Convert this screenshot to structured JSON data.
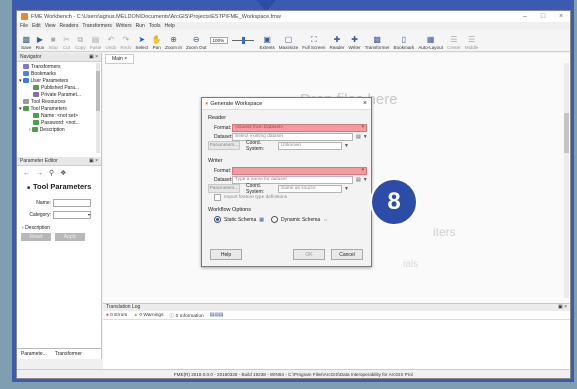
{
  "window": {
    "title": "FME Workbench - C:\\Users\\agnus.MELDON\\Documents\\ArcGIS\\Projects\\ESTP\\FME_Workspace.fmw"
  },
  "menu": [
    "File",
    "Edit",
    "View",
    "Readers",
    "Transformers",
    "Writers",
    "Run",
    "Tools",
    "Help"
  ],
  "toolbar": {
    "buttons": [
      "Save",
      "Run",
      "Stop",
      "Cut",
      "Copy",
      "Paste",
      "Undo",
      "Redo",
      "Select",
      "Pan",
      "Zoom In",
      "Zoom Out"
    ],
    "zoom": "100%",
    "right_buttons": [
      "Extents",
      "Maximize",
      "Full Screen",
      "Reader",
      "Writer",
      "Transformer",
      "Bookmark",
      "Auto-Layout",
      "Center",
      "Middle"
    ]
  },
  "navigator": {
    "title": "Navigator",
    "items": [
      "Transformers",
      "Bookmarks",
      "User Parameters",
      "Published Para...",
      "Private Paramet...",
      "Tool Resources",
      "Tool Parameters",
      "Name: <not set>",
      "Password: <not...",
      "Description"
    ]
  },
  "param_editor": {
    "title": "Parameter Editor",
    "heading": "Tool Parameters",
    "name_label": "Name:",
    "category_label": "Category:",
    "description_label": "Description",
    "reset": "Reset",
    "apply": "Apply",
    "tabs": [
      "Paramete...",
      "Transformer"
    ]
  },
  "canvas": {
    "tab": "Main",
    "drop_message": "Drop files here",
    "ghost_writers": "iters",
    "ghost_tutorials": "ials"
  },
  "translation_log": {
    "title": "Translation Log",
    "errors": "0 Errors",
    "warnings": "0 Warnings",
    "information": "0 Information"
  },
  "status_bar": "FME(R) 2019.0.0.0 - 20190328 - Build 19238 - WIN64 - C:\\Program Files\\ArcGIS\\Data Interoperability for ArcGIS Pro\\",
  "dialog": {
    "title": "Generate Workspace",
    "reader_section": "Reader",
    "reader_format_label": "Format:",
    "reader_format_value": "<Guess from Dataset>",
    "reader_dataset_label": "Dataset:",
    "reader_dataset_placeholder": "Select existing dataset",
    "reader_params": "Parameters...",
    "coord_label": "Coord. System:",
    "reader_coord_value": "Unknown",
    "writer_section": "Writer",
    "writer_format_label": "Format:",
    "writer_format_value": "",
    "writer_dataset_label": "Dataset:",
    "writer_dataset_placeholder": "Type a name for dataset",
    "writer_params": "Parameters...",
    "writer_coord_value": "Same as source",
    "import_defs": "Import feature type definitions",
    "workflow_section": "Workflow Options",
    "static_schema": "Static Schema",
    "dynamic_schema": "Dynamic Schema",
    "help": "Help",
    "ok": "OK",
    "cancel": "Cancel"
  },
  "step_badge": "8"
}
